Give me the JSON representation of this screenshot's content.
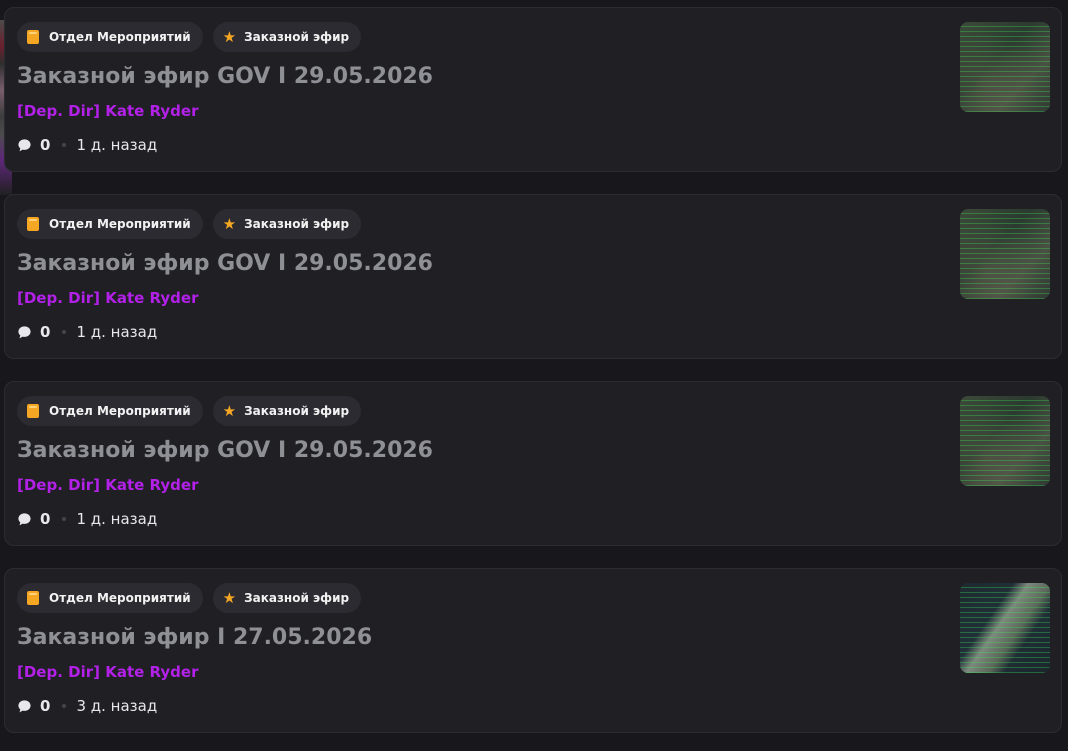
{
  "posts": [
    {
      "tag_department": "Отдел Мероприятий",
      "tag_type": "Заказной эфир",
      "title": "Заказной эфир GOV I 29.05.2026",
      "author": "[Dep. Dir] Kate Ryder",
      "comments": "0",
      "time": "1 д. назад"
    },
    {
      "tag_department": "Отдел Мероприятий",
      "tag_type": "Заказной эфир",
      "title": "Заказной эфир GOV I 29.05.2026",
      "author": "[Dep. Dir] Kate Ryder",
      "comments": "0",
      "time": "1 д. назад"
    },
    {
      "tag_department": "Отдел Мероприятий",
      "tag_type": "Заказной эфир",
      "title": "Заказной эфир GOV I 29.05.2026",
      "author": "[Dep. Dir] Kate Ryder",
      "comments": "0",
      "time": "1 д. назад"
    },
    {
      "tag_department": "Отдел Мероприятий",
      "tag_type": "Заказной эфир",
      "title": "Заказной эфир I 27.05.2026",
      "author": "[Dep. Dir] Kate Ryder",
      "comments": "0",
      "time": "3 д. назад"
    }
  ],
  "icons": {
    "department": "book-icon",
    "type": "star-icon",
    "comments": "speech-bubble-icon"
  },
  "colors": {
    "background": "#18181c",
    "card": "#1f1f24",
    "title": "#8f8f96",
    "author": "#b321e8",
    "accent": "#f5a623"
  }
}
